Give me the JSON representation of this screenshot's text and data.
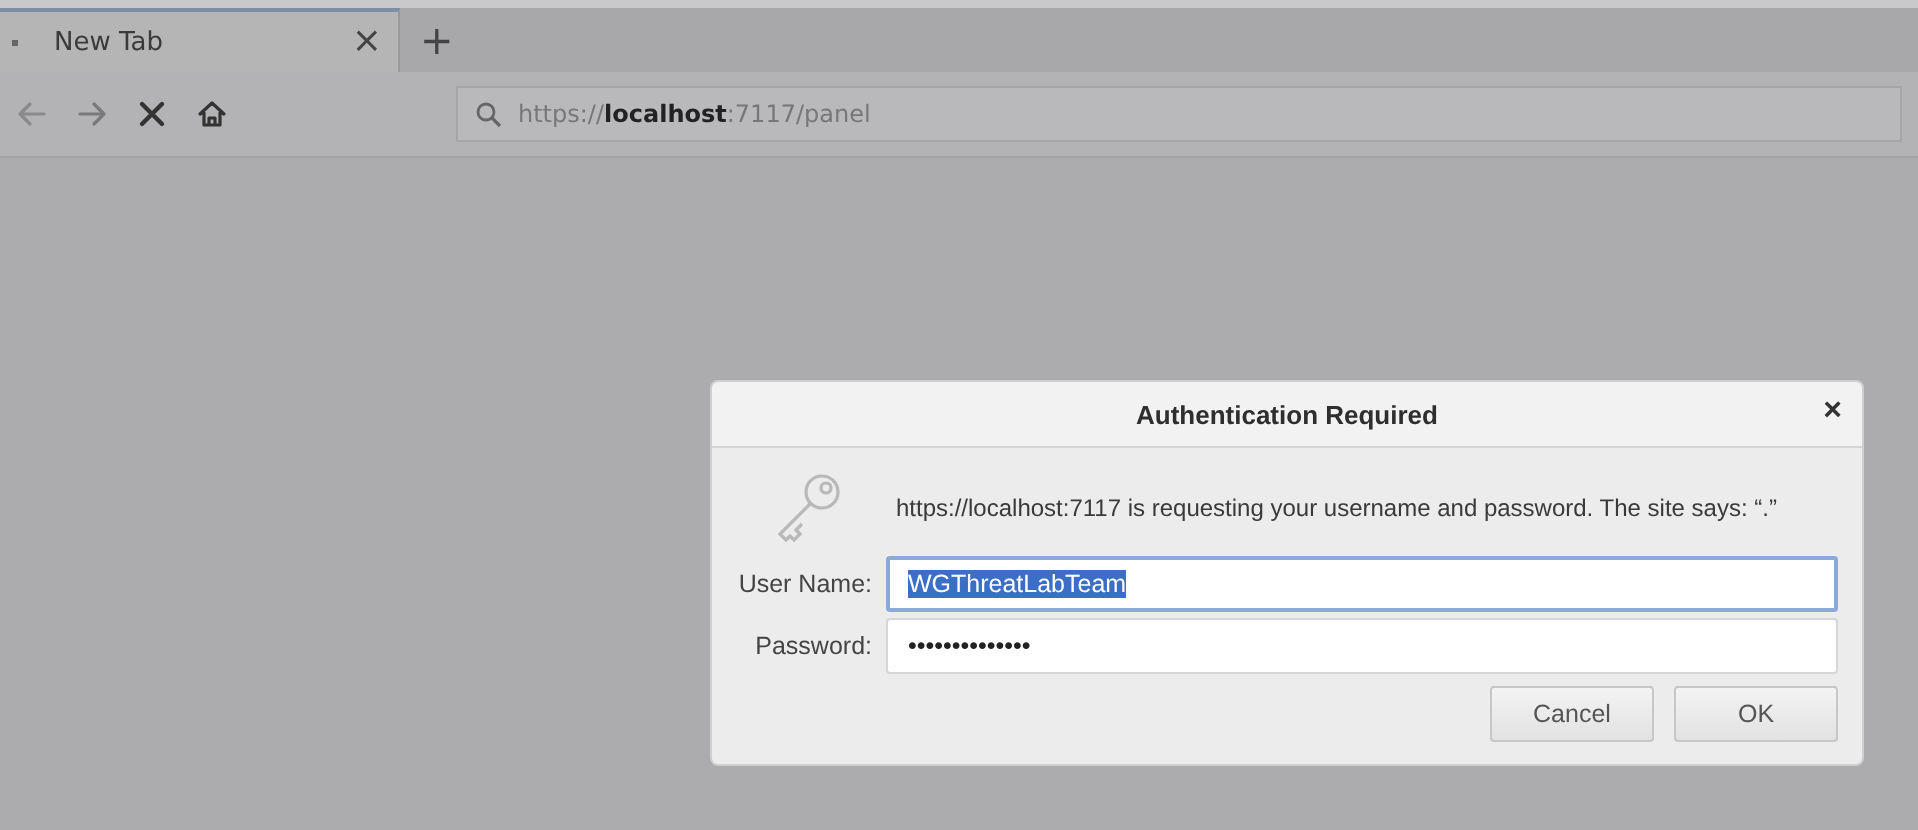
{
  "tabs": [
    {
      "label": "New Tab",
      "selected": true,
      "close": "×"
    }
  ],
  "new_tab": "+",
  "address_bar": {
    "url": "https://**localhost**:7117/panel"
  },
  "dialog": {
    "title": "Authentication Required",
    "close": "×",
    "message": "https://localhost:7117 is requesting your username and password. The site says: “.”",
    "fields": [
      {
        "label": "User Name:",
        "value": "WGThreatLabTeam",
        "focused": true,
        "text_selected": true
      },
      {
        "label": "Password:",
        "value": "••••••••••••••",
        "focused": false,
        "text_selected": false
      }
    ],
    "buttons": [
      "Cancel",
      "OK"
    ]
  }
}
